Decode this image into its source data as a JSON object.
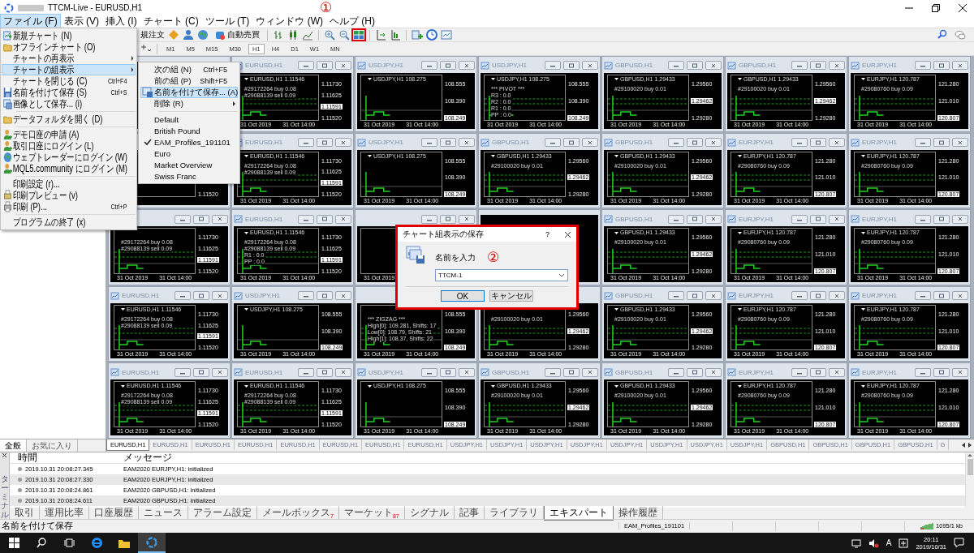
{
  "window": {
    "title": "TTCM-Live - EURUSD,H1"
  },
  "menu_bar": [
    {
      "label": "ファイル (F)",
      "selected": true
    },
    {
      "label": "表示 (V)",
      "selected": false
    },
    {
      "label": "挿入 (I)",
      "selected": false
    },
    {
      "label": "チャート (C)",
      "selected": false
    },
    {
      "label": "ツール (T)",
      "selected": false
    },
    {
      "label": "ウィンドウ (W)",
      "selected": false
    },
    {
      "label": "ヘルプ (H)",
      "selected": false
    }
  ],
  "toolbar": {
    "order_label": "規注文",
    "autotrade_label": "自動売買",
    "timeframes": [
      {
        "label": "M1",
        "selected": false
      },
      {
        "label": "M5",
        "selected": false
      },
      {
        "label": "M15",
        "selected": false
      },
      {
        "label": "M30",
        "selected": false
      },
      {
        "label": "H1",
        "selected": true
      },
      {
        "label": "H4",
        "selected": false
      },
      {
        "label": "D1",
        "selected": false
      },
      {
        "label": "W1",
        "selected": false
      },
      {
        "label": "MN",
        "selected": false
      }
    ]
  },
  "annotations": [
    "①",
    "②"
  ],
  "file_menu": [
    {
      "kind": "item",
      "label": "新規チャート (N)",
      "submenu": false,
      "selected": false
    },
    {
      "kind": "item",
      "label": "オフラインチャート (O)",
      "submenu": false,
      "selected": false
    },
    {
      "kind": "item",
      "label": "チャートの再表示",
      "submenu": true,
      "selected": false
    },
    {
      "kind": "item",
      "label": "チャートの組表示",
      "submenu": true,
      "selected": true
    },
    {
      "kind": "item",
      "label": "チャートを閉じる (C)",
      "shortcut": "Ctrl+F4",
      "submenu": false,
      "selected": false
    },
    {
      "kind": "item",
      "label": "名前を付けて保存 (S)",
      "shortcut": "Ctrl+S",
      "submenu": false,
      "selected": false
    },
    {
      "kind": "item",
      "label": "画像として保存... (i)",
      "submenu": false,
      "selected": false
    },
    {
      "kind": "separator"
    },
    {
      "kind": "item",
      "label": "データフォルダを開く (D)",
      "submenu": false,
      "selected": false
    },
    {
      "kind": "separator"
    },
    {
      "kind": "item",
      "label": "デモ口座の申請 (A)",
      "submenu": false,
      "selected": false
    },
    {
      "kind": "item",
      "label": "取引口座にログイン (L)",
      "submenu": false,
      "selected": false
    },
    {
      "kind": "item",
      "label": "ウェブトレーダーにログイン (W)",
      "submenu": false,
      "selected": false
    },
    {
      "kind": "item",
      "label": "MQL5.community にログイン (M)",
      "submenu": false,
      "selected": false
    },
    {
      "kind": "separator"
    },
    {
      "kind": "item",
      "label": "印刷設定 (r)...",
      "submenu": false,
      "selected": false
    },
    {
      "kind": "item",
      "label": "印刷プレビュー (v)",
      "submenu": false,
      "selected": false
    },
    {
      "kind": "item",
      "label": "印刷 (P)...",
      "shortcut": "Ctrl+P",
      "submenu": false,
      "selected": false
    },
    {
      "kind": "separator"
    },
    {
      "kind": "item",
      "label": "プログラムの終了 (x)",
      "submenu": false,
      "selected": false
    }
  ],
  "profiles_menu": [
    {
      "kind": "item",
      "label": "次の組 (N)",
      "shortcut": "Ctrl+F5",
      "submenu": false,
      "selected": false,
      "checked": false
    },
    {
      "kind": "item",
      "label": "前の組 (P)",
      "shortcut": "Shift+F5",
      "submenu": false,
      "selected": false,
      "checked": false
    },
    {
      "kind": "item",
      "label": "名前を付けて保存... (A)",
      "submenu": false,
      "selected": true,
      "checked": false
    },
    {
      "kind": "item",
      "label": "削除 (R)",
      "submenu": true,
      "selected": false,
      "checked": false
    },
    {
      "kind": "separator"
    },
    {
      "kind": "item",
      "label": "Default",
      "submenu": false,
      "selected": false,
      "checked": false
    },
    {
      "kind": "item",
      "label": "British Pound",
      "submenu": false,
      "selected": false,
      "checked": false
    },
    {
      "kind": "item",
      "label": "EAM_Profiles_191101",
      "submenu": false,
      "selected": false,
      "checked": true
    },
    {
      "kind": "item",
      "label": "Euro",
      "submenu": false,
      "selected": false,
      "checked": false
    },
    {
      "kind": "item",
      "label": "Market Overview",
      "submenu": false,
      "selected": false,
      "checked": false
    },
    {
      "kind": "item",
      "label": "Swiss Franc",
      "submenu": false,
      "selected": false,
      "checked": false
    }
  ],
  "left_panel_tabs": [
    {
      "label": "全般",
      "selected": true
    },
    {
      "label": "お気に入り",
      "selected": false
    }
  ],
  "charts": [
    {
      "kind": "covered"
    },
    {
      "kind": "chart",
      "title": "EURUSD,H1",
      "header": "EURUSD,H1  1.11546",
      "notes": [
        "#29172264 buy 0.08",
        "#29088139 sell 0.09"
      ],
      "prices": [
        {
          "text": "1.11730",
          "current": false
        },
        {
          "text": "1.11625",
          "current": false
        },
        {
          "text": "1.11591",
          "current": true
        },
        {
          "text": "1.11520",
          "current": false
        }
      ],
      "times": [
        "31 Oct 2019",
        "31 Oct 14:00"
      ]
    },
    {
      "kind": "chart",
      "title": "USDJPY,H1",
      "header": "USDJPY,H1  108.275",
      "prices": [
        {
          "text": "108.555",
          "current": false
        },
        {
          "text": "108.390",
          "current": false
        },
        {
          "text": "108.249",
          "current": true
        }
      ],
      "times": [
        "31 Oct 2019",
        "31 Oct 14:00"
      ]
    },
    {
      "kind": "chart",
      "title": "USDJPY,H1",
      "header": "USDJPY,H1  108.275",
      "notes": [
        "*** PIVOT ***",
        "R3 : 0.0",
        "R2 : 0.0",
        "R1 : 0.0",
        "PP : 0.0"
      ],
      "prices": [
        {
          "text": "108.555",
          "current": false
        },
        {
          "text": "108.390",
          "current": false
        },
        {
          "text": "108.249",
          "current": true
        }
      ],
      "times": [
        "31 Oct 2019",
        "31 Oct 14:00"
      ]
    },
    {
      "kind": "chart",
      "title": "GBPUSD,H1",
      "header": "GBPUSD,H1  1.29433",
      "notes": [
        "#29100020 buy 0.01"
      ],
      "prices": [
        {
          "text": "1.29560",
          "current": false
        },
        {
          "text": "1.29462",
          "current": true
        },
        {
          "text": "1.29280",
          "current": false
        }
      ],
      "times": [
        "31 Oct 2019",
        "31 Oct 14:00"
      ]
    },
    {
      "kind": "chart",
      "title": "GBPUSD,H1",
      "header": "GBPUSD,H1  1.29433",
      "notes": [
        "#29100020 buy 0.01"
      ],
      "prices": [
        {
          "text": "1.29560",
          "current": false
        },
        {
          "text": "1.29462",
          "current": true
        },
        {
          "text": "1.29280",
          "current": false
        }
      ],
      "times": [
        "31 Oct 2019",
        "31 Oct 14:00"
      ]
    },
    {
      "kind": "chart",
      "title": "EURJPY,H1",
      "header": "EURJPY,H1  120.787",
      "notes": [
        "#29080760 buy 0.09"
      ],
      "prices": [
        {
          "text": "121.280",
          "current": false
        },
        {
          "text": "121.010",
          "current": false
        },
        {
          "text": "120.807",
          "current": true
        }
      ],
      "times": [
        "31 Oct 2019",
        "31 Oct 14:00"
      ]
    },
    {
      "kind": "untitled",
      "prices": [
        {
          "text": "1.11520",
          "current": false
        }
      ]
    },
    {
      "kind": "chart",
      "title": "EURUSD,H1",
      "header": "EURUSD,H1  1.11546",
      "notes": [
        "#29172264 buy 0.08",
        "#29088139 sell 0.09"
      ],
      "prices": [
        {
          "text": "1.11730",
          "current": false
        },
        {
          "text": "1.11625",
          "current": false
        },
        {
          "text": "1.11591",
          "current": true
        },
        {
          "text": "1.11520",
          "current": false
        }
      ],
      "times": [
        "31 Oct 2019",
        "31 Oct 14:00"
      ]
    },
    {
      "kind": "chart",
      "title": "USDJPY,H1",
      "header": "USDJPY,H1  108.275",
      "prices": [
        {
          "text": "108.555",
          "current": false
        },
        {
          "text": "108.390",
          "current": false
        },
        {
          "text": "108.249",
          "current": true
        }
      ],
      "times": [
        "31 Oct 2019",
        "31 Oct 14:00"
      ]
    },
    {
      "kind": "chart",
      "title": "GBPUSD,H1",
      "header": "GBPUSD,H1  1.29433",
      "notes": [
        "#29100020 buy 0.01"
      ],
      "prices": [
        {
          "text": "1.29560",
          "current": false
        },
        {
          "text": "1.29462",
          "current": true
        },
        {
          "text": "1.29280",
          "current": false
        }
      ],
      "times": [
        "31 Oct 2019",
        "31 Oct 14:00"
      ]
    },
    {
      "kind": "chart",
      "title": "GBPUSD,H1",
      "header": "GBPUSD,H1  1.29433",
      "notes": [
        "#29100020 buy 0.01"
      ],
      "prices": [
        {
          "text": "1.29560",
          "current": false
        },
        {
          "text": "1.29462",
          "current": true
        },
        {
          "text": "1.29280",
          "current": false
        }
      ],
      "times": [
        "31 Oct 2019",
        "31 Oct 14:00"
      ]
    },
    {
      "kind": "chart",
      "title": "EURJPY,H1",
      "header": "EURJPY,H1  120.787",
      "notes": [
        "#29080760 buy 0.09"
      ],
      "prices": [
        {
          "text": "121.280",
          "current": false
        },
        {
          "text": "121.010",
          "current": false
        },
        {
          "text": "120.807",
          "current": true
        }
      ],
      "times": [
        "31 Oct 2019",
        "31 Oct 14:00"
      ]
    },
    {
      "kind": "chart",
      "title": "EURJPY,H1",
      "header": "EURJPY,H1  120.787",
      "notes": [
        "#29080760 buy 0.09"
      ],
      "prices": [
        {
          "text": "121.280",
          "current": false
        },
        {
          "text": "121.010",
          "current": false
        },
        {
          "text": "120.807",
          "current": true
        }
      ],
      "times": [
        "31 Oct 2019",
        "31 Oct 14:00"
      ]
    },
    {
      "kind": "chart",
      "notes": [
        "#29172264 buy 0.08",
        "#29088139 sell 0.09"
      ],
      "prices": [
        {
          "text": "1.11730",
          "current": false
        },
        {
          "text": "1.11625",
          "current": false
        },
        {
          "text": "1.11591",
          "current": true
        },
        {
          "text": "1.11520",
          "current": false
        }
      ],
      "times": [
        "31 Oct 2019",
        "31 Oct 14:00"
      ]
    },
    {
      "kind": "chart",
      "title": "EURUSD,H1",
      "header": "EURUSD,H1  1.11546",
      "notes": [
        "#29172264 buy 0.08",
        "#29088139 sell 0.09",
        "R1 : 0.0",
        "PP : 0.0"
      ],
      "prices": [
        {
          "text": "1.11730",
          "current": false
        },
        {
          "text": "1.11625",
          "current": false
        },
        {
          "text": "1.11591",
          "current": true
        },
        {
          "text": "1.11520",
          "current": false
        }
      ],
      "times": [
        "31 Oct 2019",
        "31 Oct 14:00"
      ]
    },
    {
      "kind": "chart",
      "times": [
        "31 Oct 2019"
      ]
    },
    {
      "kind": "covered"
    },
    {
      "kind": "chart",
      "title": "GBPUSD,H1",
      "header": "GBPUSD,H1  1.29433",
      "notes": [
        "#29100020 buy 0.01"
      ],
      "prices": [
        {
          "text": "1.29560",
          "current": false
        },
        {
          "text": "1.29462",
          "current": true
        },
        {
          "text": "1.29280",
          "current": false
        }
      ],
      "times": [
        "31 Oct 2019",
        "31 Oct 14:00"
      ]
    },
    {
      "kind": "chart",
      "title": "EURJPY,H1",
      "header": "EURJPY,H1  120.787",
      "notes": [
        "#29080760 buy 0.09"
      ],
      "prices": [
        {
          "text": "121.280",
          "current": false
        },
        {
          "text": "121.010",
          "current": false
        },
        {
          "text": "120.807",
          "current": true
        }
      ],
      "times": [
        "31 Oct 2019",
        "31 Oct 14:00"
      ]
    },
    {
      "kind": "chart",
      "title": "EURJPY,H1",
      "header": "EURJPY,H1  120.787",
      "notes": [
        "#29080760 buy 0.09"
      ],
      "prices": [
        {
          "text": "121.280",
          "current": false
        },
        {
          "text": "121.010",
          "current": false
        },
        {
          "text": "120.807",
          "current": true
        }
      ],
      "times": [
        "31 Oct 2019",
        "31 Oct 14:00"
      ]
    },
    {
      "kind": "chart",
      "title": "EURUSD,H1",
      "header": "EURUSD,H1  1.11546",
      "notes": [
        "#29172264 buy 0.08",
        "#29088139 sell 0.09"
      ],
      "prices": [
        {
          "text": "1.11730",
          "current": false
        },
        {
          "text": "1.11625",
          "current": false
        },
        {
          "text": "1.11591",
          "current": true
        },
        {
          "text": "1.11520",
          "current": false
        }
      ],
      "times": [
        "31 Oct 2019",
        "31 Oct 14:00"
      ]
    },
    {
      "kind": "chart",
      "title": "USDJPY,H1",
      "header": "USDJPY,H1  108.275",
      "prices": [
        {
          "text": "108.555",
          "current": false
        },
        {
          "text": "108.390",
          "current": false
        },
        {
          "text": "108.249",
          "current": true
        }
      ],
      "times": [
        "31 Oct 2019",
        "31 Oct 14:00"
      ]
    },
    {
      "kind": "untitled",
      "notes": [
        "*** ZIGZAG ***",
        "High[0]: 109.281, Shifts: 17",
        "Low[0]: 108.79, Shifts: 21",
        "High[1]: 108.37, Shifts: 22"
      ],
      "prices": [
        {
          "text": "108.555",
          "current": false
        },
        {
          "text": "108.390",
          "current": false
        },
        {
          "text": "108.249",
          "current": true
        }
      ],
      "times": [
        "31 Oct 2019",
        "31 Oct 14:00"
      ]
    },
    {
      "kind": "untitled",
      "notes": [
        "#29100020 buy 0.01"
      ],
      "prices": [
        {
          "text": "1.29560",
          "current": false
        },
        {
          "text": "1.29462",
          "current": true
        },
        {
          "text": "1.29280",
          "current": false
        }
      ],
      "times": [
        "31 Oct 2019",
        "31 Oct 14:00"
      ]
    },
    {
      "kind": "chart",
      "title": "GBPUSD,H1",
      "header": "GBPUSD,H1  1.29433",
      "notes": [
        "#29100020 buy 0.01"
      ],
      "prices": [
        {
          "text": "1.29560",
          "current": false
        },
        {
          "text": "1.29462",
          "current": true
        },
        {
          "text": "1.29280",
          "current": false
        }
      ],
      "times": [
        "31 Oct 2019",
        "31 Oct 14:00"
      ]
    },
    {
      "kind": "chart",
      "title": "EURJPY,H1",
      "header": "EURJPY,H1  120.787",
      "notes": [
        "#29080760 buy 0.09"
      ],
      "prices": [
        {
          "text": "121.280",
          "current": false
        },
        {
          "text": "121.010",
          "current": false
        },
        {
          "text": "120.807",
          "current": true
        }
      ],
      "times": [
        "31 Oct 2019",
        "31 Oct 14:00"
      ]
    },
    {
      "kind": "chart",
      "title": "EURJPY,H1",
      "header": "EURJPY,H1  120.787",
      "notes": [
        "#29080760 buy 0.09"
      ],
      "prices": [
        {
          "text": "121.280",
          "current": false
        },
        {
          "text": "121.010",
          "current": false
        },
        {
          "text": "120.807",
          "current": true
        }
      ],
      "times": [
        "31 Oct 2019",
        "31 Oct 14:00"
      ]
    },
    {
      "kind": "chart",
      "title": "EURUSD,H1",
      "header": "EURUSD,H1  1.11546",
      "notes": [
        "#29172264 buy 0.08",
        "#29088139 sell 0.09"
      ],
      "prices": [
        {
          "text": "1.11730",
          "current": false
        },
        {
          "text": "1.11625",
          "current": false
        },
        {
          "text": "1.11591",
          "current": true
        },
        {
          "text": "1.11520",
          "current": false
        }
      ],
      "times": [
        "31 Oct 2019",
        "31 Oct 14:00"
      ]
    },
    {
      "kind": "chart",
      "title": "EURUSD,H1",
      "header": "EURUSD,H1  1.11546",
      "notes": [
        "#29172264 buy 0.08",
        "#29088139 sell 0.09"
      ],
      "prices": [
        {
          "text": "1.11730",
          "current": false
        },
        {
          "text": "1.11625",
          "current": false
        },
        {
          "text": "1.11591",
          "current": true
        },
        {
          "text": "1.11520",
          "current": false
        }
      ],
      "times": [
        "31 Oct 2019",
        "31 Oct 14:00"
      ]
    },
    {
      "kind": "chart",
      "title": "USDJPY,H1",
      "header": "USDJPY,H1  108.275",
      "prices": [
        {
          "text": "108.555",
          "current": false
        },
        {
          "text": "108.390",
          "current": false
        },
        {
          "text": "108.249",
          "current": true
        }
      ],
      "times": [
        "31 Oct 2019",
        "31 Oct 14:00"
      ]
    },
    {
      "kind": "chart",
      "title": "GBPUSD,H1",
      "header": "GBPUSD,H1  1.29433",
      "notes": [
        "#29100020 buy 0.01"
      ],
      "prices": [
        {
          "text": "1.29560",
          "current": false
        },
        {
          "text": "1.29462",
          "current": true
        },
        {
          "text": "1.29280",
          "current": false
        }
      ],
      "times": [
        "31 Oct 2019",
        "31 Oct 14:00"
      ]
    },
    {
      "kind": "chart",
      "title": "GBPUSD,H1",
      "header": "GBPUSD,H1  1.29433",
      "notes": [
        "#29100020 buy 0.01"
      ],
      "prices": [
        {
          "text": "1.29560",
          "current": false
        },
        {
          "text": "1.29462",
          "current": true
        },
        {
          "text": "1.29280",
          "current": false
        }
      ],
      "times": [
        "31 Oct 2019",
        "31 Oct 14:00"
      ]
    },
    {
      "kind": "chart",
      "title": "EURJPY,H1",
      "header": "EURJPY,H1  120.787",
      "notes": [
        "#29080760 buy 0.09"
      ],
      "prices": [
        {
          "text": "121.280",
          "current": false
        },
        {
          "text": "121.010",
          "current": false
        },
        {
          "text": "120.807",
          "current": true
        }
      ],
      "times": [
        "31 Oct 2019",
        "31 Oct 14:00"
      ]
    },
    {
      "kind": "chart",
      "title": "EURJPY,H1",
      "header": "EURJPY,H1  120.787",
      "notes": [
        "#29080760 buy 0.09"
      ],
      "prices": [
        {
          "text": "121.280",
          "current": false
        },
        {
          "text": "121.010",
          "current": false
        },
        {
          "text": "120.807",
          "current": true
        }
      ],
      "times": [
        "31 Oct 2019",
        "31 Oct 14:00"
      ]
    }
  ],
  "chart_tabs": [
    {
      "label": "EURUSD,H1",
      "selected": true
    },
    {
      "label": "EURUSD,H1",
      "selected": false
    },
    {
      "label": "EURUSD,H1",
      "selected": false
    },
    {
      "label": "EURUSD,H1",
      "selected": false
    },
    {
      "label": "EURUSD,H1",
      "selected": false
    },
    {
      "label": "EURUSD,H1",
      "selected": false
    },
    {
      "label": "EURUSD,H1",
      "selected": false
    },
    {
      "label": "EURUSD,H1",
      "selected": false
    },
    {
      "label": "USDJPY,H1",
      "selected": false
    },
    {
      "label": "USDJPY,H1",
      "selected": false
    },
    {
      "label": "USDJPY,H1",
      "selected": false
    },
    {
      "label": "USDJPY,H1",
      "selected": false
    },
    {
      "label": "USDJPY,H1",
      "selected": false
    },
    {
      "label": "USDJPY,H1",
      "selected": false
    },
    {
      "label": "USDJPY,H1",
      "selected": false
    },
    {
      "label": "USDJPY,H1",
      "selected": false
    },
    {
      "label": "GBPUSD,H1",
      "selected": false
    },
    {
      "label": "GBPUSD,H1",
      "selected": false
    },
    {
      "label": "GBPUSD,H1",
      "selected": false
    },
    {
      "label": "GBPUSD,H1",
      "selected": false
    },
    {
      "label": "G",
      "selected": false
    }
  ],
  "dialog": {
    "title": "チャート組表示の保存",
    "help": "?",
    "prompt": "名前を入力",
    "value": "TTCM-1",
    "buttons": [
      "OK",
      "キャンセル"
    ]
  },
  "terminal": {
    "side_label": "ターミナル",
    "columns": [
      "時間",
      "メッセージ"
    ],
    "rows": [
      {
        "time": "2019.10.31 20:08:27.345",
        "message": "EAM2020 EURJPY,H1: initialized"
      },
      {
        "time": "2019.10.31 20:08:27.330",
        "message": "EAM2020 EURJPY,H1: initialized"
      },
      {
        "time": "2019.10.31 20:08:24.861",
        "message": "EAM2020 GBPUSD,H1: initialized"
      },
      {
        "time": "2019.10.31 20:08:24.611",
        "message": "EAM2020 GBPUSD,H1: initialized"
      }
    ],
    "tabs": [
      {
        "label": "取引",
        "selected": false
      },
      {
        "label": "運用比率",
        "selected": false
      },
      {
        "label": "口座履歴",
        "selected": false
      },
      {
        "label": "ニュース",
        "selected": false
      },
      {
        "label": "アラーム設定",
        "selected": false
      },
      {
        "label": "メールボックス",
        "badge": "7",
        "selected": false
      },
      {
        "label": "マーケット",
        "badge": "87",
        "selected": false
      },
      {
        "label": "シグナル",
        "selected": false
      },
      {
        "label": "記事",
        "selected": false
      },
      {
        "label": "ライブラリ",
        "selected": false
      },
      {
        "label": "エキスパート",
        "selected": true
      },
      {
        "label": "操作履歴",
        "selected": false
      }
    ]
  },
  "status_bar": {
    "message": "名前を付けて保存",
    "profile": "EAM_Profiles_191101",
    "traffic": "1095/1 kb"
  },
  "taskbar": {
    "ime": "A",
    "time": "20:11",
    "date": "2019/10/31"
  }
}
